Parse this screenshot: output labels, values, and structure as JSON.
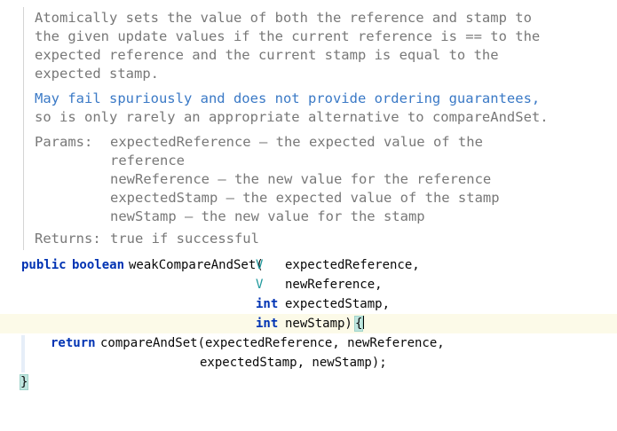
{
  "doc": {
    "description": [
      "Atomically sets the value of both the reference and stamp to",
      "the given update values if the current reference is == to the",
      "expected reference and the current stamp is equal to the",
      "expected stamp."
    ],
    "note_line1": "May fail spuriously and does not provide ordering guarantees,",
    "note_line2_pre": "so is only rarely an appropriate alternative to ",
    "note_link": "compareAndSet",
    "note_line2_post": ".",
    "params_label": "Params:",
    "params": [
      "expectedReference – the expected value of the",
      "reference",
      "newReference – the new value for the reference",
      "expectedStamp – the expected value of the stamp",
      "newStamp – the new value for the stamp"
    ],
    "returns_label": "Returns:",
    "returns_value": "true if successful"
  },
  "code": {
    "kw_public": "public",
    "kw_boolean": "boolean",
    "method_name": "weakCompareAndSet(",
    "type_v": "V",
    "kw_int": "int",
    "param1": "expectedReference,",
    "param2": "newReference,",
    "param3": "expectedStamp,",
    "param4": "newStamp)",
    "open_brace": "{",
    "kw_return": "return",
    "return_line1": "compareAndSet(expectedReference, newReference,",
    "return_line2": "expectedStamp, newStamp);",
    "close_brace": "}"
  }
}
